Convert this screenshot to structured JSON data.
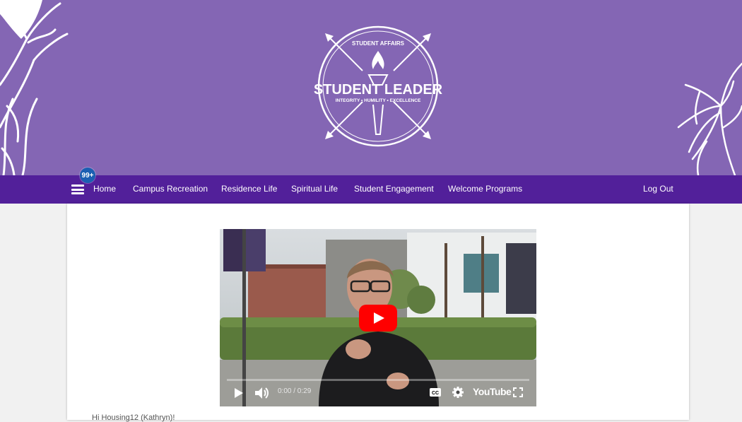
{
  "logo": {
    "top_text": "STUDENT AFFAIRS",
    "title": "STUDENT LEADER",
    "tagline": "INTEGRITY • HUMILITY • EXCELLENCE"
  },
  "nav": {
    "badge": "99+",
    "items": [
      {
        "label": "Home"
      },
      {
        "label": "Campus Recreation"
      },
      {
        "label": "Residence Life"
      },
      {
        "label": "Spiritual Life"
      },
      {
        "label": "Student Engagement"
      },
      {
        "label": "Welcome Programs"
      }
    ],
    "logout": "Log Out"
  },
  "video": {
    "time": "0:00 / 0:29",
    "brand": "YouTube",
    "progress": 0
  },
  "greeting": "Hi Housing12 (Kathryn)!",
  "colors": {
    "banner": "#8466b4",
    "navbar": "#52209a",
    "badge": "#1b5fb2",
    "play_button": "#ff0000"
  }
}
